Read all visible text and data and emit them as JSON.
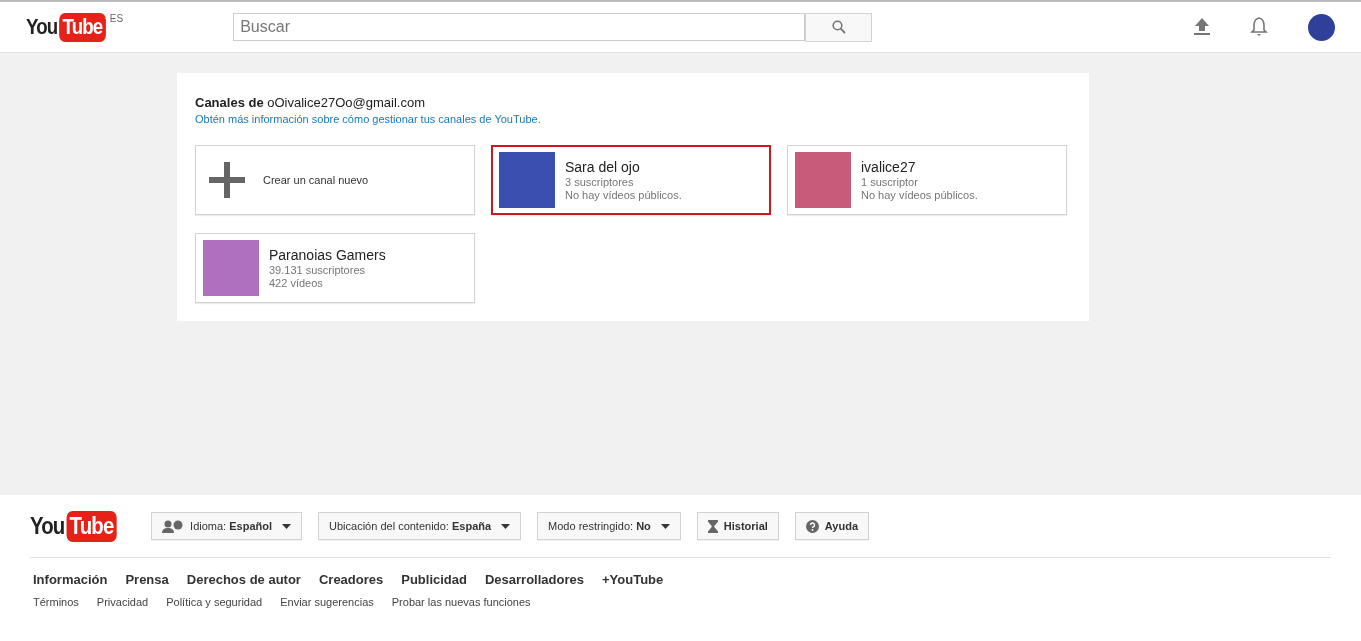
{
  "header": {
    "logo": {
      "you": "You",
      "tube": "Tube",
      "region": "ES"
    },
    "search": {
      "placeholder": "Buscar"
    }
  },
  "channels_panel": {
    "title_label": "Canales de",
    "email": "oOivalice27Oo@gmail.com",
    "help_link": "Obtén más información sobre cómo gestionar tus canales de YouTube.",
    "cards": [
      {
        "kind": "create",
        "label": "Crear un canal nuevo",
        "selected": false
      },
      {
        "kind": "channel",
        "name": "Sara del ojo",
        "subscribers": "3 suscriptores",
        "videos": "No hay vídeos públicos.",
        "selected": true,
        "color": "#3a4fb0"
      },
      {
        "kind": "channel",
        "name": "ivalice27",
        "subscribers": "1 suscriptor",
        "videos": "No hay vídeos públicos.",
        "selected": false,
        "color": "#c85a7a"
      },
      {
        "kind": "channel",
        "name": "Paranoias Gamers",
        "subscribers": "39.131 suscriptores",
        "videos": "422 vídeos",
        "selected": false,
        "color": "#b070c0"
      }
    ]
  },
  "footer": {
    "logo": {
      "you": "You",
      "tube": "Tube"
    },
    "buttons": [
      {
        "kind": "language",
        "label": "Idioma:",
        "value": "Español",
        "dropdown": true
      },
      {
        "kind": "plain",
        "label": "Ubicación del contenido:",
        "value": "España",
        "dropdown": true
      },
      {
        "kind": "plain",
        "label": "Modo restringido:",
        "value": "No",
        "dropdown": true
      },
      {
        "kind": "history",
        "value": "Historial",
        "dropdown": false
      },
      {
        "kind": "help",
        "value": "Ayuda",
        "dropdown": false
      }
    ],
    "primary_links": [
      "Información",
      "Prensa",
      "Derechos de autor",
      "Creadores",
      "Publicidad",
      "Desarrolladores",
      "+YouTube"
    ],
    "secondary_links": [
      "Términos",
      "Privacidad",
      "Política y seguridad",
      "Enviar sugerencias",
      "Probar las nuevas funciones"
    ]
  }
}
